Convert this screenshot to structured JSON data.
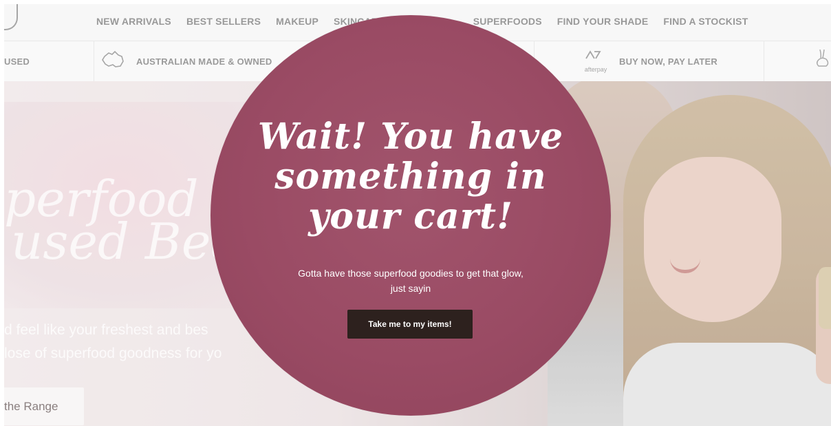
{
  "nav": {
    "links": [
      "NEW ARRIVALS",
      "BEST SELLERS",
      "MAKEUP",
      "SKINCARE",
      "SUPERFOODS",
      "FIND YOUR SHADE",
      "FIND A STOCKIST"
    ]
  },
  "usp": {
    "item1": "USED",
    "item2": "AUSTRALIAN MADE & OWNED",
    "item3": "BUY NOW, PAY LATER",
    "afterpay_logo_text": "afterpay"
  },
  "hero": {
    "script_line1": "perfood",
    "script_line2": "used Bea",
    "copy_line1": "d feel like your freshest and bes",
    "copy_line2": "lose of superfood goodness for yo",
    "range_button": "the Range"
  },
  "popup": {
    "heading_line1": "Wait! You have",
    "heading_line2": "something in",
    "heading_line3": "your cart!",
    "subtext_line1": "Gotta have those superfood goodies to get that glow,",
    "subtext_line2": "just sayin",
    "button_label": "Take me to my items!",
    "background_color": "#9a4b64",
    "button_color": "#2d211e"
  }
}
